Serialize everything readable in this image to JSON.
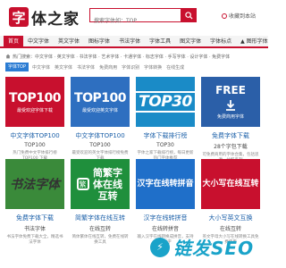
{
  "header": {
    "logo_mark": "字",
    "logo_text": "体之家",
    "search_placeholder": "搜索字体如：TOP",
    "link_label": "收藏到本站"
  },
  "nav": [
    {
      "label": "首页",
      "active": true
    },
    {
      "label": "中文字体"
    },
    {
      "label": "英文字体"
    },
    {
      "label": "图标字体"
    },
    {
      "label": "书法字体"
    },
    {
      "label": "字体工具"
    },
    {
      "label": "图文字体"
    },
    {
      "label": "字体标点"
    },
    {
      "label": "▲ 图形字体"
    }
  ],
  "breadcrumb": {
    "label": "热门搜索：",
    "items": [
      "中文字体 · 英文字体 · 书法字体 · 艺术字体 · 卡通字体 · 标志字体 · 手写字体 · 设计字体 · 免费字体"
    ]
  },
  "tagbar": {
    "head": "字体TOP",
    "tags": [
      "中文字体",
      "英文字体",
      "书法字体",
      "免费商用",
      "字体识别",
      "字体转换",
      "在线生成"
    ]
  },
  "row1": [
    {
      "thumb_main": "TOP100",
      "thumb_sub": "最受欢迎字体下载",
      "title": "中文字体TOP100",
      "sub": "TOP100",
      "desc": "热门免费中文字体排行榜 TOP100 下载",
      "color": "#c8102e"
    },
    {
      "thumb_main": "TOP100",
      "thumb_sub": "最受欢迎英文字体",
      "title": "中文字体TOP100",
      "sub": "TOP100",
      "desc": "最受欢迎的英文字体排行榜免费下载",
      "color": "#2e6fc0"
    },
    {
      "thumb_main": "TOP30",
      "title": "字体下载排行榜",
      "sub": "TOP30",
      "desc": "字体之家下载排行榜，每日更新热门字体推荐",
      "color": "#1a8bc7"
    },
    {
      "thumb_main": "FREE",
      "thumb_sub": "免费商用字体",
      "title": "免费字体下载",
      "sub": "28个字包下载",
      "desc": "可免费商用的字体合集，包括思源、站酷系列",
      "color": "#2b5fa8"
    }
  ],
  "row2": [
    {
      "thumb_main": "书法字体",
      "title": "免费字体下载",
      "sub": "书法字体",
      "desc": "书法字体免费下载大全，精选书法字体",
      "color": "#3a8a3a"
    },
    {
      "thumb_main": "简繁字体在线互转",
      "title": "简繁字体在线互转",
      "sub": "在线互转",
      "desc": "简体繁体在线互转，免费在线转换工具",
      "color": "#1f8f3c"
    },
    {
      "thumb_main": "汉字在线转拼音",
      "title": "汉字在线转拼音",
      "sub": "在线转拼音",
      "desc": "输入汉字在线转换成拼音，支持多音字",
      "color": "#1f6fc9"
    },
    {
      "thumb_main": "大小写在线互转",
      "title": "大小写英文互换",
      "sub": "在线互转",
      "desc": "英文字母大小写在线转换工具免费使用",
      "color": "#c8102e"
    }
  ],
  "watermark": "链发SEO"
}
